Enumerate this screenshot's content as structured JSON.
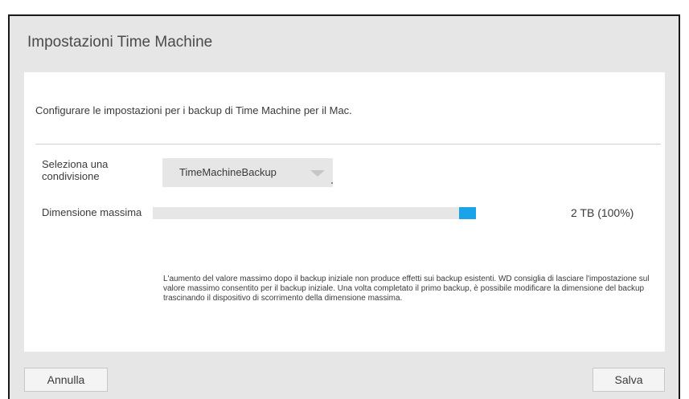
{
  "dialog": {
    "title": "Impostazioni Time Machine",
    "intro": "Configurare le impostazioni per i backup di Time Machine per il Mac.",
    "share": {
      "label": "Seleziona una condivisione",
      "selected": "TimeMachineBackup"
    },
    "max_size": {
      "label": "Dimensione massima",
      "value_text": "2 TB (100%)",
      "percent": 100
    },
    "note": "L'aumento del valore massimo dopo il backup iniziale non produce effetti sui backup esistenti. WD consiglia di lasciare l'impostazione sul valore massimo consentito per il backup iniziale. Una volta completato il primo backup, è possibile modificare la dimensione del backup trascinando il dispositivo di scorrimento della dimensione massima.",
    "buttons": {
      "cancel": "Annulla",
      "save": "Salva"
    }
  },
  "colors": {
    "accent": "#1aa3e8",
    "background": "#e6e6e6",
    "panel": "#ffffff"
  },
  "icons": {
    "dropdown": "chevron-down-icon"
  }
}
